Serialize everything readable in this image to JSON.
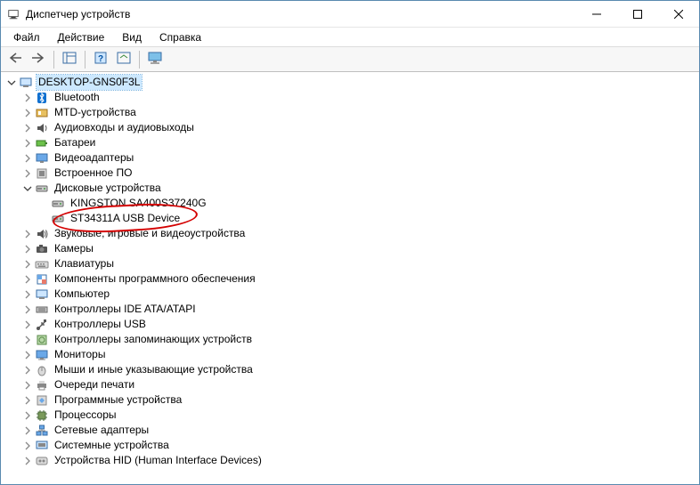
{
  "window": {
    "title": "Диспетчер устройств"
  },
  "menu": {
    "file": "Файл",
    "action": "Действие",
    "view": "Вид",
    "help": "Справка"
  },
  "tree": {
    "root": {
      "label": "DESKTOP-GNS0F3L"
    },
    "items": [
      {
        "label": "Bluetooth",
        "icon": "bluetooth",
        "expanded": false,
        "children": []
      },
      {
        "label": "MTD-устройства",
        "icon": "mtd",
        "expanded": false,
        "children": []
      },
      {
        "label": "Аудиовходы и аудиовыходы",
        "icon": "audio",
        "expanded": false,
        "children": []
      },
      {
        "label": "Батареи",
        "icon": "battery",
        "expanded": false,
        "children": []
      },
      {
        "label": "Видеоадаптеры",
        "icon": "display",
        "expanded": false,
        "children": []
      },
      {
        "label": "Встроенное ПО",
        "icon": "firmware",
        "expanded": false,
        "children": []
      },
      {
        "label": "Дисковые устройства",
        "icon": "disk",
        "expanded": true,
        "children": [
          {
            "label": "KINGSTON SA400S37240G",
            "icon": "disk"
          },
          {
            "label": "ST34311A USB Device",
            "icon": "disk",
            "circled": true
          }
        ]
      },
      {
        "label": "Звуковые, игровые и видеоустройства",
        "icon": "sound",
        "expanded": false,
        "children": []
      },
      {
        "label": "Камеры",
        "icon": "camera",
        "expanded": false,
        "children": []
      },
      {
        "label": "Клавиатуры",
        "icon": "keyboard",
        "expanded": false,
        "children": []
      },
      {
        "label": "Компоненты программного обеспечения",
        "icon": "software",
        "expanded": false,
        "children": []
      },
      {
        "label": "Компьютер",
        "icon": "computer",
        "expanded": false,
        "children": []
      },
      {
        "label": "Контроллеры IDE ATA/ATAPI",
        "icon": "ide",
        "expanded": false,
        "children": []
      },
      {
        "label": "Контроллеры USB",
        "icon": "usb",
        "expanded": false,
        "children": []
      },
      {
        "label": "Контроллеры запоминающих устройств",
        "icon": "storage",
        "expanded": false,
        "children": []
      },
      {
        "label": "Мониторы",
        "icon": "monitor",
        "expanded": false,
        "children": []
      },
      {
        "label": "Мыши и иные указывающие устройства",
        "icon": "mouse",
        "expanded": false,
        "children": []
      },
      {
        "label": "Очереди печати",
        "icon": "printer",
        "expanded": false,
        "children": []
      },
      {
        "label": "Программные устройства",
        "icon": "softdev",
        "expanded": false,
        "children": []
      },
      {
        "label": "Процессоры",
        "icon": "cpu",
        "expanded": false,
        "children": []
      },
      {
        "label": "Сетевые адаптеры",
        "icon": "network",
        "expanded": false,
        "children": []
      },
      {
        "label": "Системные устройства",
        "icon": "system",
        "expanded": false,
        "children": []
      },
      {
        "label": "Устройства HID (Human Interface Devices)",
        "icon": "hid",
        "expanded": false,
        "children": []
      }
    ]
  },
  "colors": {
    "highlight": "#cce8ff",
    "annotation": "#d40000"
  }
}
